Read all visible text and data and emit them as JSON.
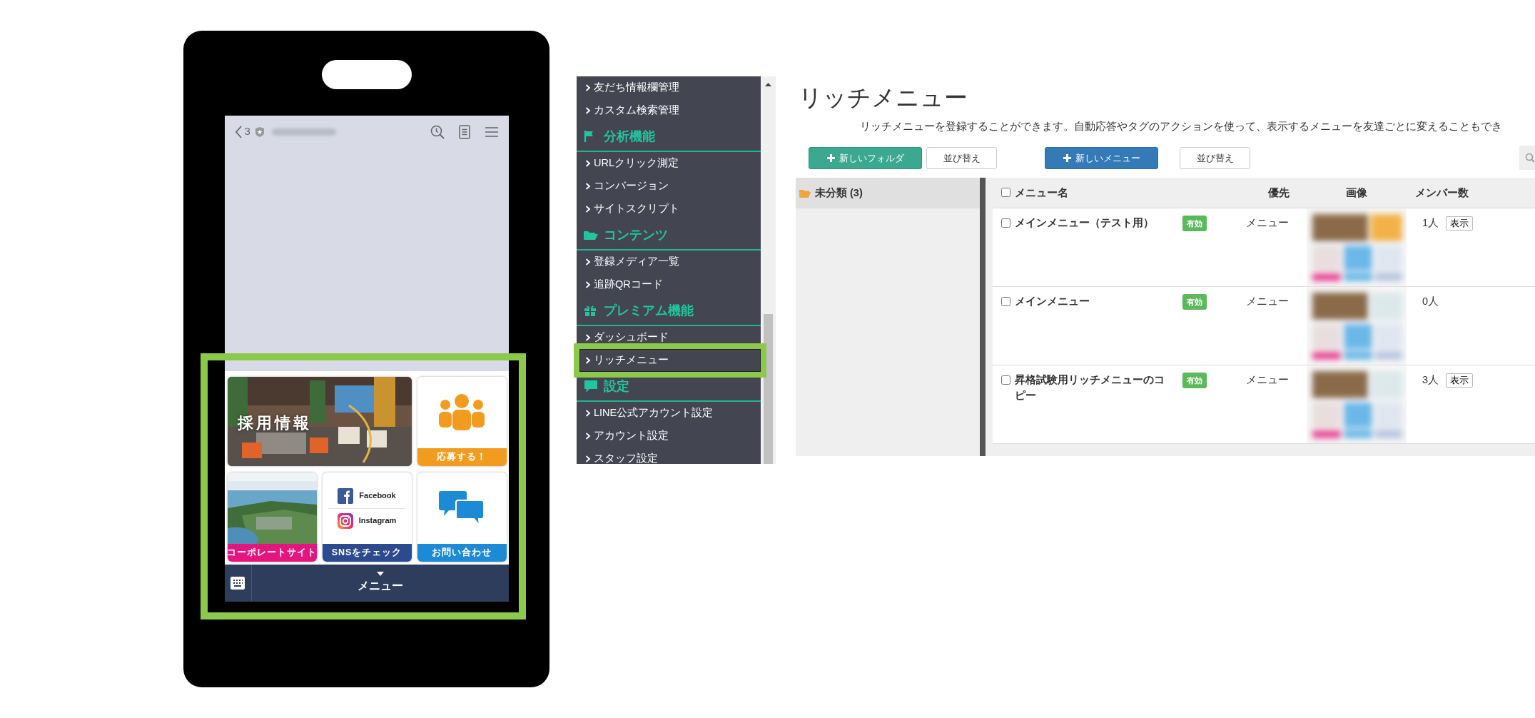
{
  "phone": {
    "top_bar": {
      "back_count": "3"
    },
    "rich_menu": {
      "tiles": [
        {
          "kind": "photo-banner",
          "overlay_text": "採用情報"
        },
        {
          "kind": "people",
          "label": "応募する！",
          "color": "#f29c1f"
        },
        {
          "label": "コーポレートサイト",
          "color": "#e4157f"
        },
        {
          "kind": "sns",
          "links": [
            "Facebook",
            "Instagram"
          ],
          "label": "SNSをチェック",
          "color": "#2c4a8e"
        },
        {
          "kind": "chat",
          "label": "お問い合わせ",
          "color": "#1d8ad6"
        }
      ]
    },
    "bottom_bar": {
      "label": "メニュー"
    }
  },
  "sidebar": {
    "sections": [
      {
        "items": [
          {
            "label": "友だち情報欄管理",
            "selected": false
          },
          {
            "label": "カスタム検索管理",
            "selected": false
          }
        ]
      },
      {
        "heading": "分析機能",
        "items": [
          {
            "label": "URLクリック測定",
            "selected": false
          },
          {
            "label": "コンバージョン",
            "selected": false
          },
          {
            "label": "サイトスクリプト",
            "selected": false
          }
        ]
      },
      {
        "heading": "コンテンツ",
        "items": [
          {
            "label": "登録メディア一覧",
            "selected": false
          },
          {
            "label": "追跡QRコード",
            "selected": false
          }
        ]
      },
      {
        "heading": "プレミアム機能",
        "items": [
          {
            "label": "ダッシュボード",
            "selected": false
          },
          {
            "label": "リッチメニュー",
            "selected": true
          }
        ]
      },
      {
        "heading": "設定",
        "items": [
          {
            "label": "LINE公式アカウント設定",
            "selected": false
          },
          {
            "label": "アカウント設定",
            "selected": false
          },
          {
            "label": "スタッフ設定",
            "selected": false
          }
        ]
      }
    ]
  },
  "main": {
    "title": "リッチメニュー",
    "description": "リッチメニューを登録することができます。自動応答やタグのアクションを使って、表示するメニューを友達ごとに変えることもでき",
    "folder_buttons": [
      {
        "label": "新しいフォルダ",
        "kind": "success"
      },
      {
        "label": "並び替え",
        "kind": "default"
      }
    ],
    "menu_buttons": [
      {
        "label": "新しいメニュー",
        "kind": "primary"
      },
      {
        "label": "並び替え",
        "kind": "default"
      }
    ],
    "folders": [
      {
        "label": "未分類 (3)",
        "selected": true
      }
    ],
    "table": {
      "select_all_checked": false,
      "columns": [
        "メニュー名",
        "優先",
        "画像",
        "メンバー数"
      ],
      "rows": [
        {
          "checked": false,
          "name": "メインメニュー（テスト用）",
          "status": "有効",
          "priority": "メニュー",
          "members": "1人",
          "action": "表示"
        },
        {
          "checked": false,
          "name": "メインメニュー",
          "status": "有効",
          "priority": "メニュー",
          "members": "0人"
        },
        {
          "checked": false,
          "name": "昇格試験用リッチメニューのコピー",
          "status": "有効",
          "priority": "メニュー",
          "members": "3人",
          "action": "表示"
        }
      ]
    }
  }
}
